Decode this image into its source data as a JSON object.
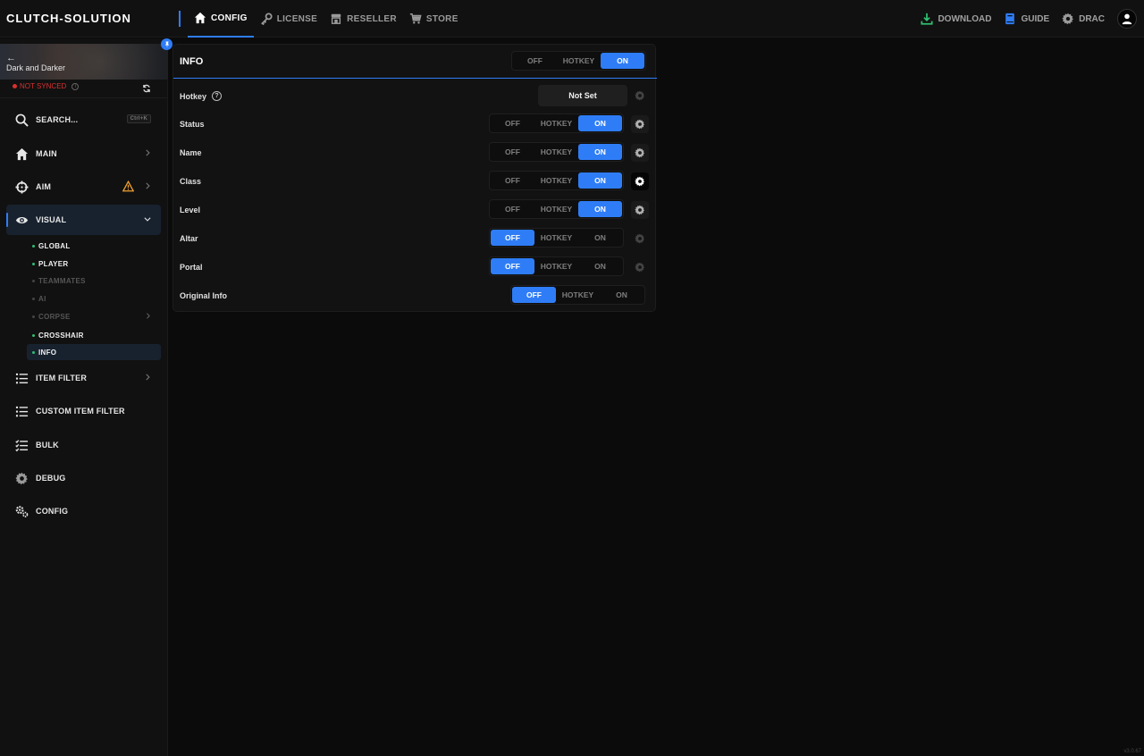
{
  "brand": "CLUTCH-SOLUTION",
  "topnav": [
    {
      "label": "CONFIG",
      "icon": "home-icon",
      "active": true
    },
    {
      "label": "LICENSE",
      "icon": "key-icon",
      "active": false
    },
    {
      "label": "RESELLER",
      "icon": "store-icon",
      "active": false
    },
    {
      "label": "STORE",
      "icon": "cart-icon",
      "active": false
    }
  ],
  "topright": {
    "download": "DOWNLOAD",
    "guide": "GUIDE",
    "user": "DRAC"
  },
  "colors": {
    "accent": "#2f7df6",
    "sync_error": "#d93030",
    "active_bullet": "#2fbf71",
    "download_icon": "#2fbf71",
    "warning": "#f0a030"
  },
  "sidebar": {
    "game_title": "Dark and Darker",
    "back_glyph": "←",
    "sync_status": "NOT SYNCED",
    "search_label": "SEARCH...",
    "search_shortcut": "Ctrl+K",
    "items": [
      {
        "label": "MAIN",
        "icon": "home-icon"
      },
      {
        "label": "AIM",
        "icon": "crosshair-icon",
        "warning": true
      },
      {
        "label": "VISUAL",
        "icon": "eye-icon",
        "active": true
      },
      {
        "label": "ITEM FILTER",
        "icon": "list-icon"
      },
      {
        "label": "CUSTOM ITEM FILTER",
        "icon": "list-icon"
      },
      {
        "label": "BULK",
        "icon": "checklist-icon"
      },
      {
        "label": "DEBUG",
        "icon": "gear-icon"
      },
      {
        "label": "CONFIG",
        "icon": "gears-icon"
      }
    ],
    "visual_sub": [
      {
        "label": "GLOBAL",
        "state": "on"
      },
      {
        "label": "PLAYER",
        "state": "on"
      },
      {
        "label": "TEAMMATES",
        "state": "off"
      },
      {
        "label": "AI",
        "state": "off"
      },
      {
        "label": "CORPSE",
        "state": "off"
      },
      {
        "label": "CROSSHAIR",
        "state": "on"
      },
      {
        "label": "INFO",
        "state": "active"
      }
    ]
  },
  "panel": {
    "title": "INFO",
    "options": [
      "OFF",
      "HOTKEY",
      "ON"
    ],
    "header_selected": "ON",
    "hotkey_label": "Hotkey",
    "hotkey_help": "?",
    "hotkey_value": "Not Set",
    "rows": [
      {
        "label": "Status",
        "selected": "ON"
      },
      {
        "label": "Name",
        "selected": "ON"
      },
      {
        "label": "Class",
        "selected": "ON"
      },
      {
        "label": "Level",
        "selected": "ON"
      },
      {
        "label": "Altar",
        "selected": "OFF"
      },
      {
        "label": "Portal",
        "selected": "OFF"
      },
      {
        "label": "Original Info",
        "selected": "OFF"
      }
    ]
  },
  "version": "v3.0.67"
}
